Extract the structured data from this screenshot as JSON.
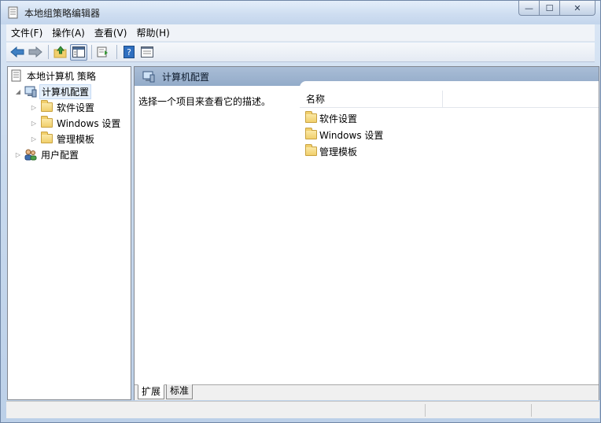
{
  "window": {
    "title": "本地组策略编辑器",
    "controls": {
      "minimize": "—",
      "maximize": "☐",
      "close": "✕"
    }
  },
  "menu": [
    "文件(F)",
    "操作(A)",
    "查看(V)",
    "帮助(H)"
  ],
  "toolbar": {
    "icons": [
      "back-arrow-icon",
      "forward-arrow-icon",
      "up-folder-icon",
      "show-hide-tree-icon",
      "export-list-icon",
      "help-icon",
      "properties-icon"
    ]
  },
  "tree": {
    "root": "本地计算机 策略",
    "computer_config": "计算机配置",
    "children": [
      "软件设置",
      "Windows 设置",
      "管理模板"
    ],
    "user_config": "用户配置"
  },
  "right_pane": {
    "header_title": "计算机配置",
    "description": "选择一个项目来查看它的描述。",
    "column_name": "名称",
    "items": [
      "软件设置",
      "Windows 设置",
      "管理模板"
    ],
    "tabs": [
      "扩展",
      "标准"
    ]
  },
  "colors": {
    "header_bar": "#93abc9",
    "folder": "#f1cf6c",
    "window_frame": "#c9daee"
  }
}
